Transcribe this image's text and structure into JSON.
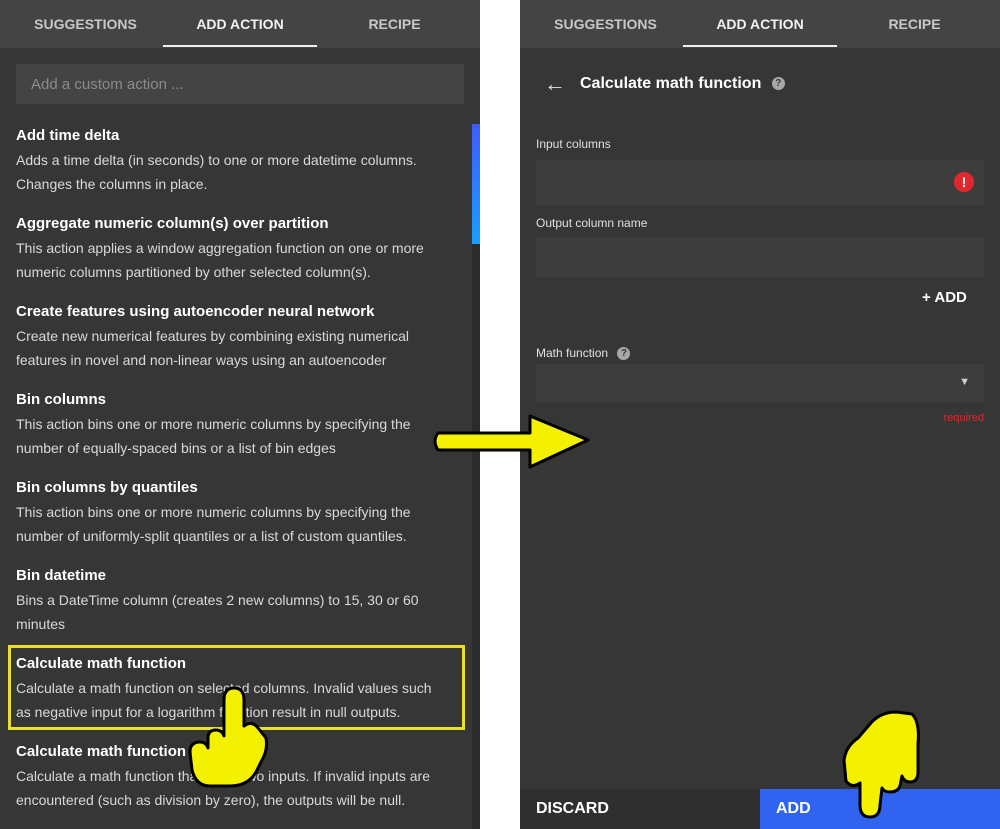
{
  "tabs": [
    "SUGGESTIONS",
    "ADD ACTION",
    "RECIPE"
  ],
  "left": {
    "custom_action_placeholder": "Add a custom action ...",
    "actions": [
      {
        "title": "Add time delta",
        "desc": [
          "Adds a time delta (in seconds) to one or more datetime columns.",
          "Changes the columns in place."
        ]
      },
      {
        "title": "Aggregate numeric column(s) over partition",
        "desc": [
          "This action applies a window aggregation function on one or more",
          "numeric columns partitioned by other selected column(s)."
        ]
      },
      {
        "title": "Create features using autoencoder neural network",
        "desc": [
          "Create new numerical features by combining existing numerical",
          "features in novel and non-linear ways using an autoencoder"
        ]
      },
      {
        "title": "Bin columns",
        "desc": [
          "This action bins one or more numeric columns by specifying the",
          "number of equally-spaced bins or a list of bin edges"
        ]
      },
      {
        "title": "Bin columns by quantiles",
        "desc": [
          "This action bins one or more numeric columns by specifying the",
          "number of uniformly-split quantiles or a list of custom quantiles."
        ]
      },
      {
        "title": "Bin datetime",
        "desc": [
          "Bins a DateTime column (creates 2 new columns) to 15, 30 or 60",
          "minutes"
        ]
      },
      {
        "title": "Calculate math function",
        "desc": [
          "Calculate a math function on selected columns. Invalid values such",
          "as negative input for a logarithm function result in null outputs."
        ]
      },
      {
        "title": "Calculate math function (2)",
        "desc": [
          "Calculate a math function that takes two inputs. If invalid inputs are",
          "encountered (such as division by zero), the outputs will be null."
        ]
      }
    ]
  },
  "right": {
    "title": "Calculate math function",
    "input_columns_label": "Input columns",
    "output_column_label": "Output column name",
    "add_label": "+ ADD",
    "math_function_label": "Math function",
    "required_text": "required",
    "discard_label": "DISCARD",
    "add_button_label": "ADD"
  },
  "colors": {
    "accent": "#2f63f0",
    "highlight": "#e8e02a",
    "error": "#e0282e"
  },
  "icons": [
    "back-arrow-icon",
    "help-icon",
    "error-icon",
    "caret-down-icon",
    "pointing-hand-icon",
    "arrow-right-icon"
  ]
}
